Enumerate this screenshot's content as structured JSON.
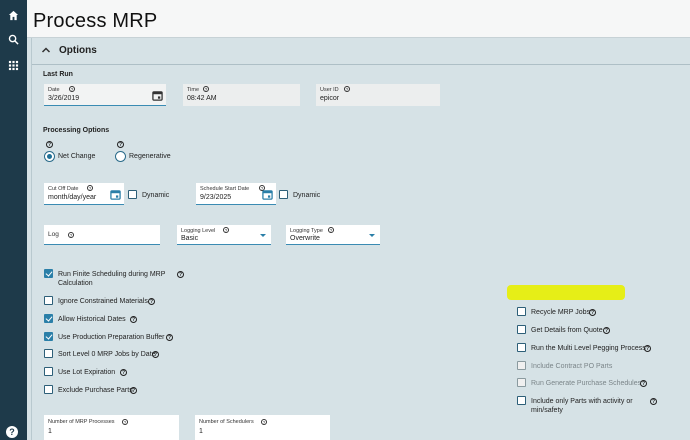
{
  "page": {
    "title": "Process MRP"
  },
  "options_section": {
    "label": "Options"
  },
  "last_run": {
    "label": "Last Run",
    "date": {
      "label": "Date",
      "value": "3/26/2019"
    },
    "time": {
      "label": "Time",
      "value": "08:42 AM"
    },
    "user_id": {
      "label": "User ID",
      "value": "epicor"
    }
  },
  "processing_options": {
    "label": "Processing Options",
    "net_change": {
      "label": "Net Change",
      "selected": true
    },
    "regenerative": {
      "label": "Regenerative",
      "selected": false
    }
  },
  "cut_off_date": {
    "label": "Cut Off Date",
    "placeholder": "month/day/year",
    "dynamic_label": "Dynamic"
  },
  "schedule_start_date": {
    "label": "Schedule Start Date",
    "value": "9/23/2025",
    "dynamic_label": "Dynamic"
  },
  "log": {
    "label": "Log"
  },
  "logging_level": {
    "label": "Logging Level",
    "value": "Basic"
  },
  "logging_type": {
    "label": "Logging Type",
    "value": "Overwrite"
  },
  "left_checks": [
    {
      "label": "Run Finite Scheduling during MRP",
      "label2": "Calculation",
      "checked": true
    },
    {
      "label": "Ignore Constrained Materials",
      "checked": false
    },
    {
      "label": "Allow Historical Dates",
      "checked": true
    },
    {
      "label": "Use Production Preparation Buffer",
      "checked": true
    },
    {
      "label": "Sort Level 0 MRP Jobs by Date",
      "checked": false
    },
    {
      "label": "Use Lot Expiration",
      "checked": false
    },
    {
      "label": "Exclude Purchase Parts",
      "checked": false
    }
  ],
  "right_checks": [
    {
      "label": "Recycle MRP Jobs",
      "checked": false,
      "disabled": false
    },
    {
      "label": "Get Details from Quote",
      "checked": false,
      "disabled": false,
      "highlighted": true
    },
    {
      "label": "Run the Multi Level Pegging Process",
      "checked": false,
      "disabled": false
    },
    {
      "label": "Include Contract PO Parts",
      "checked": false,
      "disabled": true
    },
    {
      "label": "Run Generate Purchase Schedules",
      "checked": false,
      "disabled": true
    },
    {
      "label": "Include only Parts with activity or",
      "label2": "min/safety",
      "checked": false,
      "disabled": false
    }
  ],
  "num_mrp_processes": {
    "label": "Number of MRP Processes",
    "value": "1"
  },
  "num_schedulers": {
    "label": "Number of Schedulers",
    "value": "1"
  },
  "icons": {
    "home": "home-icon",
    "search": "search-icon",
    "apps": "grid-icon",
    "help": "help-icon",
    "calendar": "calendar-icon",
    "chevron": "chevron-up-icon",
    "help_symbol": "?"
  },
  "colors": {
    "rail": "#1e3a4a",
    "accent": "#2a7fa8",
    "highlight": "#e8f000"
  }
}
